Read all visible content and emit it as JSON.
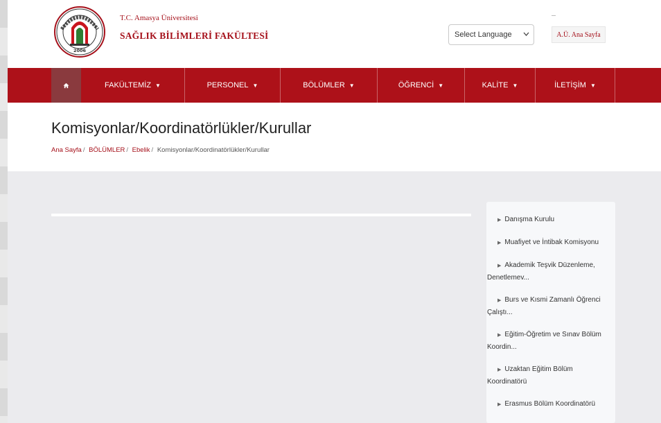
{
  "header": {
    "university": "T.C. Amasya Üniversitesi",
    "faculty": "SAĞLIK BİLİMLERİ FAKÜLTESİ",
    "logo": {
      "icon": "amasya-universitesi-seal",
      "top_text": "AMASYA ÜNİVERSİTESİ",
      "year": "2006",
      "color": "#a5101a"
    },
    "language_select": {
      "selected": "Select Language"
    },
    "home_link": "A.Ü. Ana Sayfa"
  },
  "nav": {
    "home_icon": "home-icon",
    "items": [
      {
        "label": "FAKÜLTEMİZ"
      },
      {
        "label": "PERSONEL"
      },
      {
        "label": "BÖLÜMLER"
      },
      {
        "label": "ÖĞRENCİ"
      },
      {
        "label": "KALİTE"
      },
      {
        "label": "İLETİŞİM"
      }
    ],
    "color": "#ad1119"
  },
  "page": {
    "title": "Komisyonlar/Koordinatörlükler/Kurullar",
    "breadcrumb": [
      "Ana Sayfa",
      "BÖLÜMLER",
      "Ebelik",
      "Komisyonlar/Koordinatörlükler/Kurullar"
    ]
  },
  "sidebar": {
    "items": [
      {
        "label": "Danışma Kurulu"
      },
      {
        "label": "Muafiyet ve İntibak Komisyonu"
      },
      {
        "label": "Akademik Teşvik Düzenleme, Denetlemev..."
      },
      {
        "label": "Burs ve Kısmi Zamanlı Öğrenci Çalıştı..."
      },
      {
        "label": "Eğitim-Öğretim ve Sınav Bölüm Koordin..."
      },
      {
        "label": "Uzaktan Eğitim Bölüm Koordinatörü"
      },
      {
        "label": "Erasmus Bölüm Koordinatörü"
      }
    ]
  }
}
